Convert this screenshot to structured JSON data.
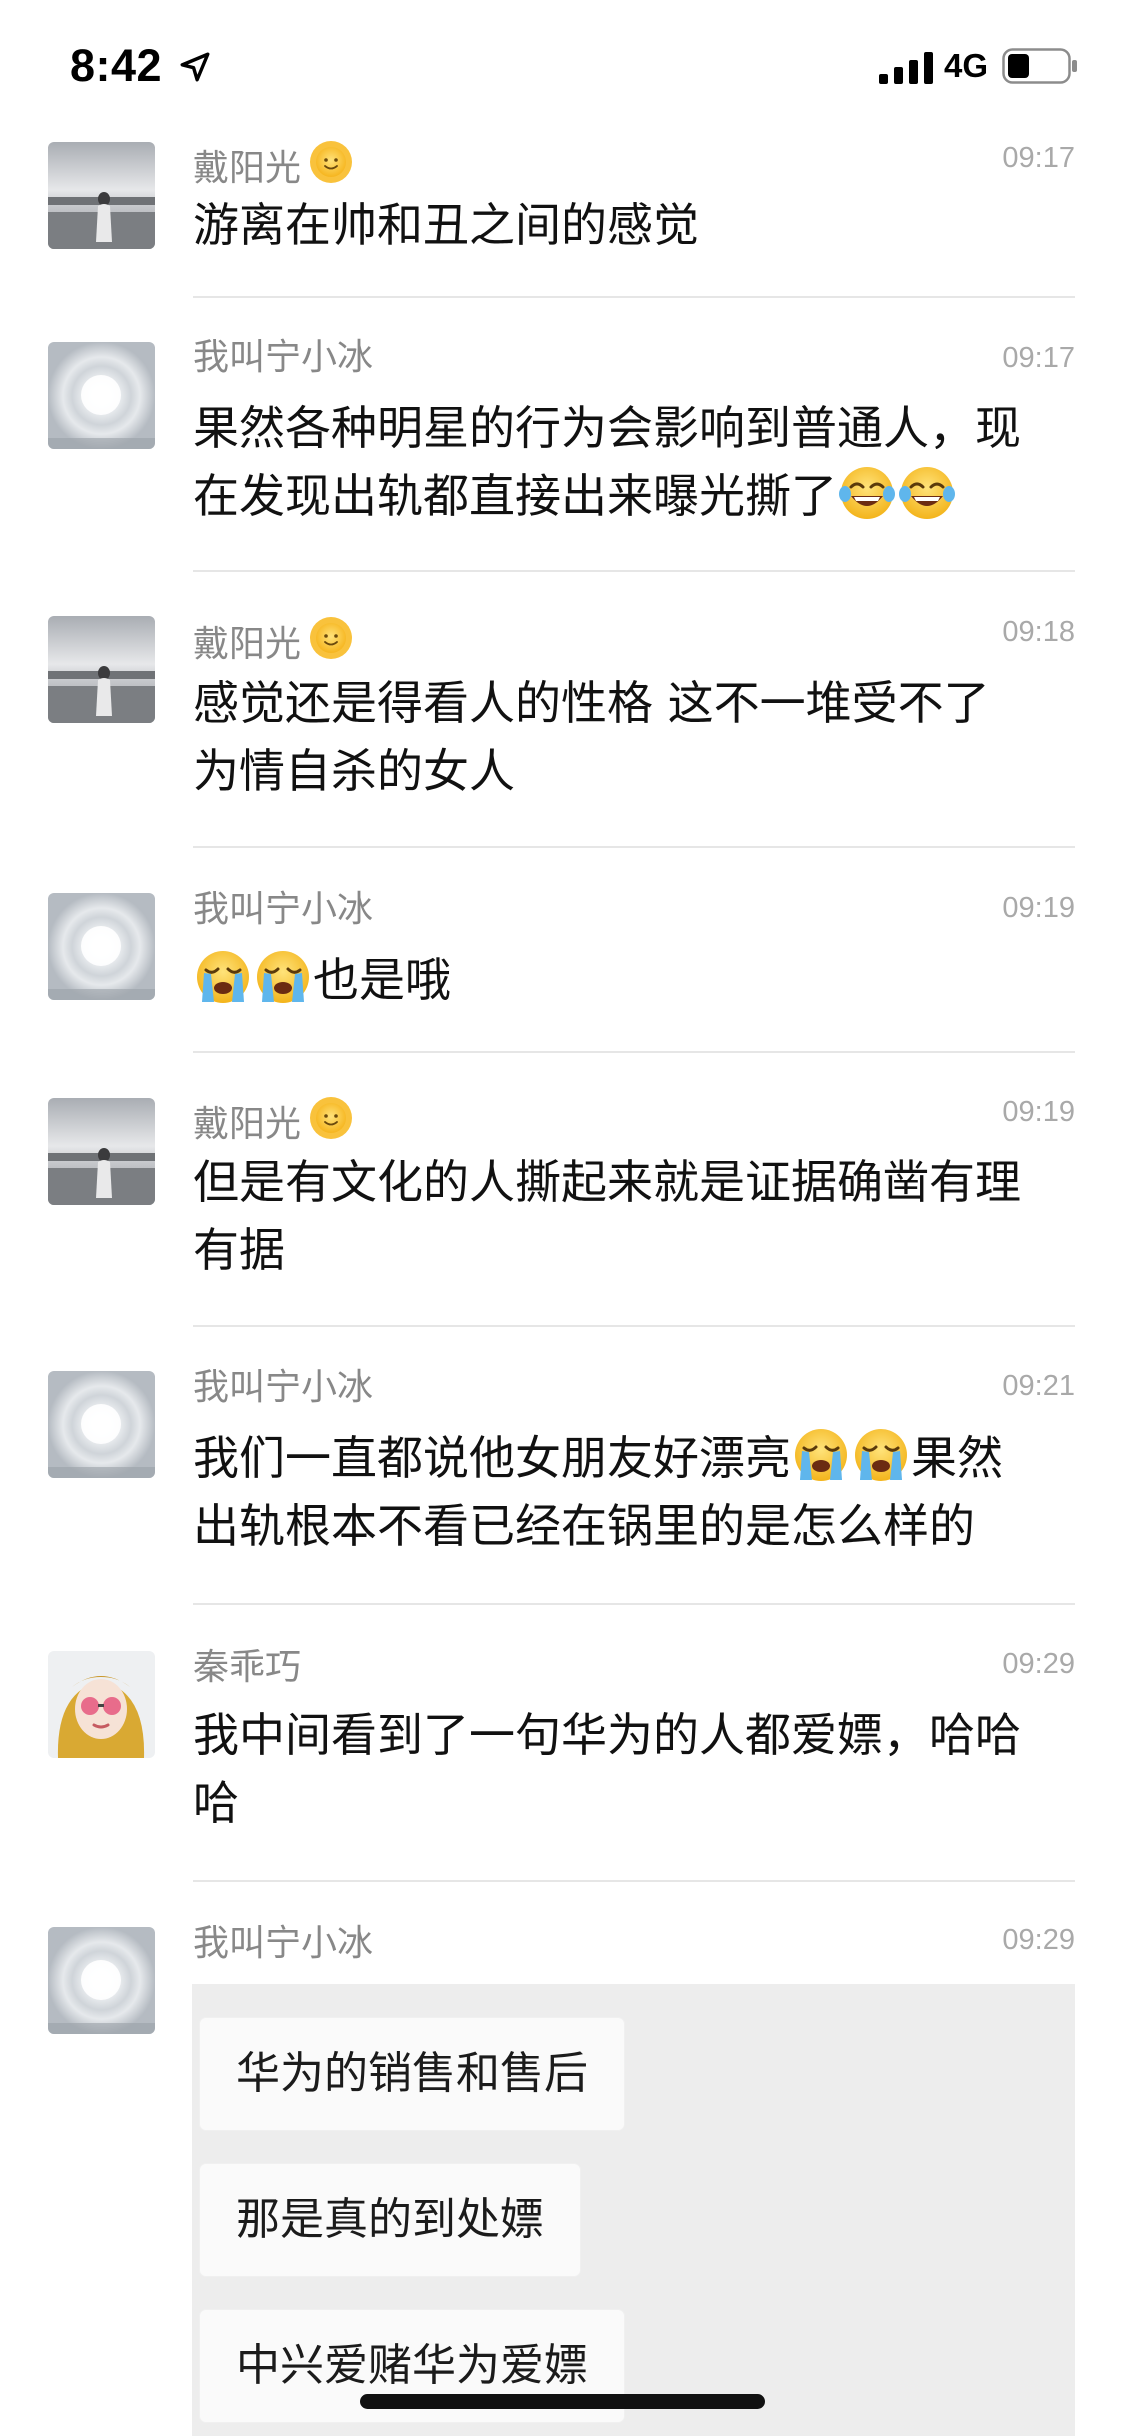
{
  "status_bar": {
    "time": "8:42",
    "network": "4G"
  },
  "messages": [
    {
      "sender": "戴阳光",
      "time": "09:17",
      "parts": [
        "游离在帅和丑之间的感觉"
      ]
    },
    {
      "sender": "我叫宁小冰",
      "time": "09:17",
      "parts": [
        "果然各种明星的行为会影响到普通人，现",
        "在发现出轨都直接出来曝光撕了"
      ]
    },
    {
      "sender": "戴阳光",
      "time": "09:18",
      "parts": [
        "感觉还是得看人的性格 这不一堆受不了",
        "为情自杀的女人"
      ]
    },
    {
      "sender": "我叫宁小冰",
      "time": "09:19",
      "parts": [
        "也是哦"
      ]
    },
    {
      "sender": "戴阳光",
      "time": "09:19",
      "parts": [
        "但是有文化的人撕起来就是证据确凿有理",
        "有据"
      ]
    },
    {
      "sender": "我叫宁小冰",
      "time": "09:21",
      "parts": [
        "我们一直都说他女朋友好漂亮",
        "果然",
        "出轨根本不看已经在锅里的是怎么样的"
      ]
    },
    {
      "sender": "秦乖巧",
      "time": "09:29",
      "parts": [
        "我中间看到了一句华为的人都爱嫖，哈哈",
        "哈"
      ]
    },
    {
      "sender": "我叫宁小冰",
      "time": "09:29"
    }
  ],
  "quoted_image": {
    "lines": [
      "华为的销售和售后",
      "那是真的到处嫖",
      "中兴爱赌华为爱嫖"
    ]
  },
  "icons": {
    "sun": "sun-emoji",
    "laugh": "face-with-tears-of-joy-emoji",
    "cry": "loudly-crying-face-emoji"
  },
  "colors": {
    "name": "#888888",
    "time": "#a9a9a9",
    "divider": "#e6e6e6",
    "background": "#ffffff"
  }
}
